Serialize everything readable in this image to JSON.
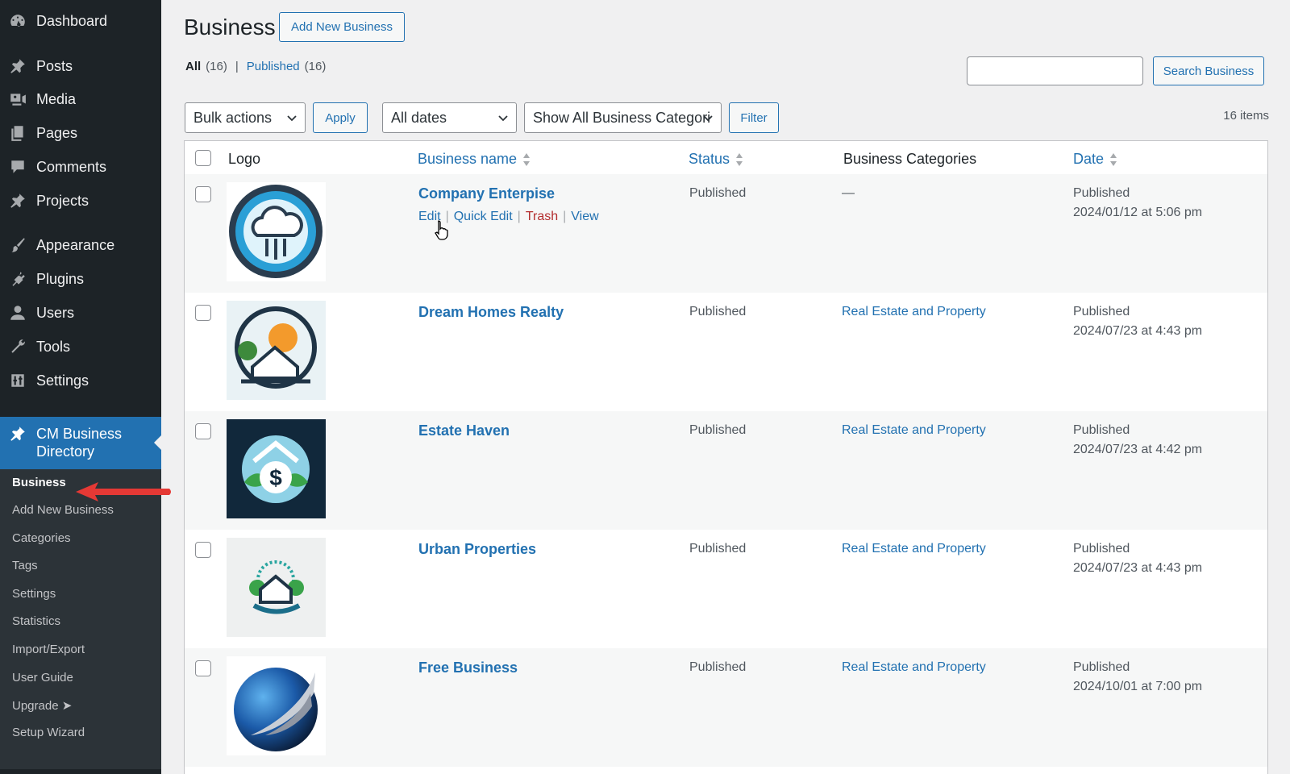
{
  "sidebar": {
    "items": [
      {
        "label": "Dashboard",
        "icon": "dashboard-icon"
      },
      {
        "label": "Posts",
        "icon": "pin-icon"
      },
      {
        "label": "Media",
        "icon": "media-icon"
      },
      {
        "label": "Pages",
        "icon": "pages-icon"
      },
      {
        "label": "Comments",
        "icon": "comment-icon"
      },
      {
        "label": "Projects",
        "icon": "pin-icon"
      },
      {
        "label": "Appearance",
        "icon": "brush-icon"
      },
      {
        "label": "Plugins",
        "icon": "plugin-icon"
      },
      {
        "label": "Users",
        "icon": "user-icon"
      },
      {
        "label": "Tools",
        "icon": "wrench-icon"
      },
      {
        "label": "Settings",
        "icon": "sliders-icon"
      }
    ],
    "current": {
      "label": "CM Business Directory",
      "icon": "pin-icon"
    },
    "submenu": [
      "Business",
      "Add New Business",
      "Categories",
      "Tags",
      "Settings",
      "Statistics",
      "Import/Export",
      "User Guide",
      "Upgrade ➤",
      "Setup Wizard"
    ]
  },
  "header": {
    "title": "Business",
    "add_new_label": "Add New Business"
  },
  "filters": {
    "all_label": "All",
    "all_count": "(16)",
    "separator": "|",
    "published_label": "Published",
    "published_count": "(16)"
  },
  "search": {
    "button_label": "Search Business",
    "value": ""
  },
  "toolbar": {
    "bulk_actions": "Bulk actions",
    "apply_label": "Apply",
    "dates": "All dates",
    "categories": "Show All Business Categori",
    "filter_label": "Filter",
    "items_count": "16 items"
  },
  "table": {
    "columns": {
      "logo": "Logo",
      "name": "Business name",
      "status": "Status",
      "categories": "Business Categories",
      "date": "Date"
    },
    "row_actions": {
      "edit": "Edit",
      "quick_edit": "Quick Edit",
      "trash": "Trash",
      "view": "View",
      "sep": "|"
    },
    "rows": [
      {
        "name": "Company Enterpise",
        "status": "Published",
        "category": "—",
        "date_label": "Published",
        "date": "2024/01/12 at 5:06 pm"
      },
      {
        "name": "Dream Homes Realty",
        "status": "Published",
        "category": "Real Estate and Property",
        "date_label": "Published",
        "date": "2024/07/23 at 4:43 pm"
      },
      {
        "name": "Estate Haven",
        "status": "Published",
        "category": "Real Estate and Property",
        "date_label": "Published",
        "date": "2024/07/23 at 4:42 pm"
      },
      {
        "name": "Urban Properties",
        "status": "Published",
        "category": "Real Estate and Property",
        "date_label": "Published",
        "date": "2024/07/23 at 4:43 pm"
      },
      {
        "name": "Free Business",
        "status": "Published",
        "category": "Real Estate and Property",
        "date_label": "Published",
        "date": "2024/10/01 at 7:00 pm"
      }
    ]
  },
  "colors": {
    "accent": "#2271b1",
    "sidebar": "#1d2327",
    "trash": "#b32d2e",
    "annotation": "#e53935"
  }
}
